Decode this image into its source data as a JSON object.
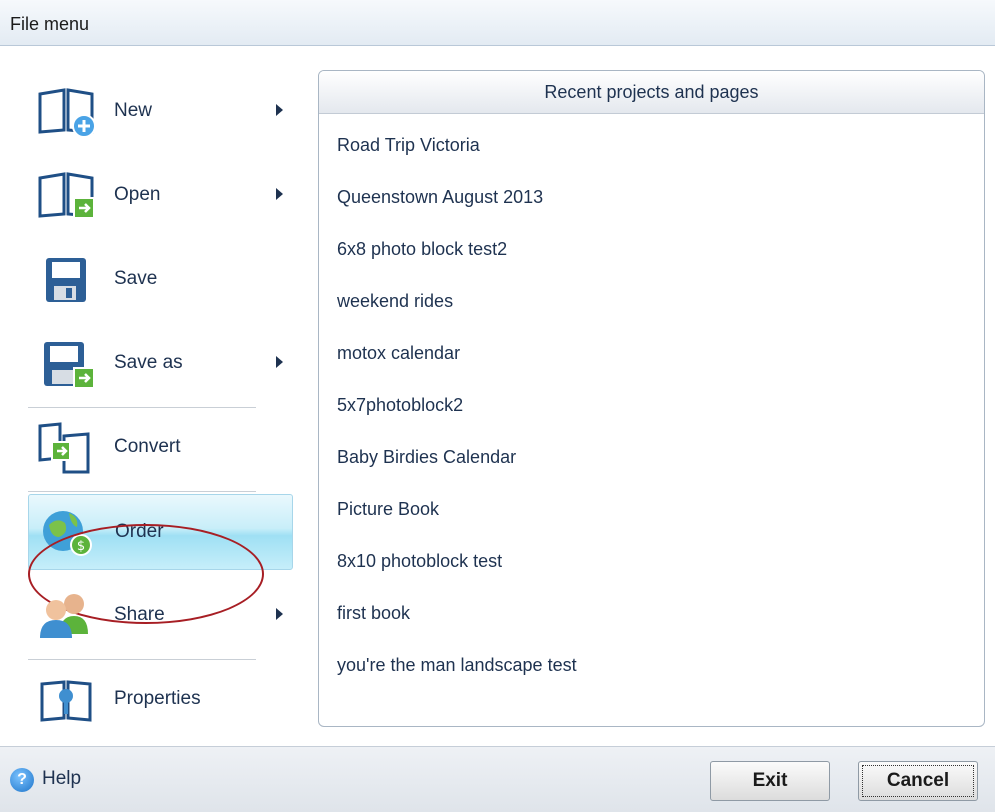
{
  "window": {
    "title": "File menu"
  },
  "menu": {
    "items": [
      {
        "label": "New",
        "icon": "new-book-icon",
        "submenu": true
      },
      {
        "label": "Open",
        "icon": "open-book-icon",
        "submenu": true
      },
      {
        "label": "Save",
        "icon": "save-disk-icon",
        "submenu": false
      },
      {
        "label": "Save as",
        "icon": "save-as-disk-icon",
        "submenu": true
      },
      {
        "label": "Convert",
        "icon": "convert-book-icon",
        "submenu": false
      },
      {
        "label": "Order",
        "icon": "globe-order-icon",
        "submenu": false,
        "active": true
      },
      {
        "label": "Share",
        "icon": "people-share-icon",
        "submenu": true
      },
      {
        "label": "Properties",
        "icon": "properties-icon",
        "submenu": false
      }
    ]
  },
  "recent": {
    "header": "Recent projects and pages",
    "items": [
      "Road Trip Victoria",
      "Queenstown August 2013",
      "6x8 photo block test2",
      "weekend rides",
      "motox calendar",
      "5x7photoblock2",
      "Baby Birdies Calendar",
      "Picture Book",
      "8x10 photoblock test",
      "first book",
      "you're the man landscape test"
    ]
  },
  "footer": {
    "help_label": "Help",
    "help_icon": "?",
    "exit_label": "Exit",
    "cancel_label": "Cancel"
  },
  "colors": {
    "text": "#1e3250",
    "active_highlight": "#9fe0f4",
    "annotation_ring": "#a71e24"
  }
}
